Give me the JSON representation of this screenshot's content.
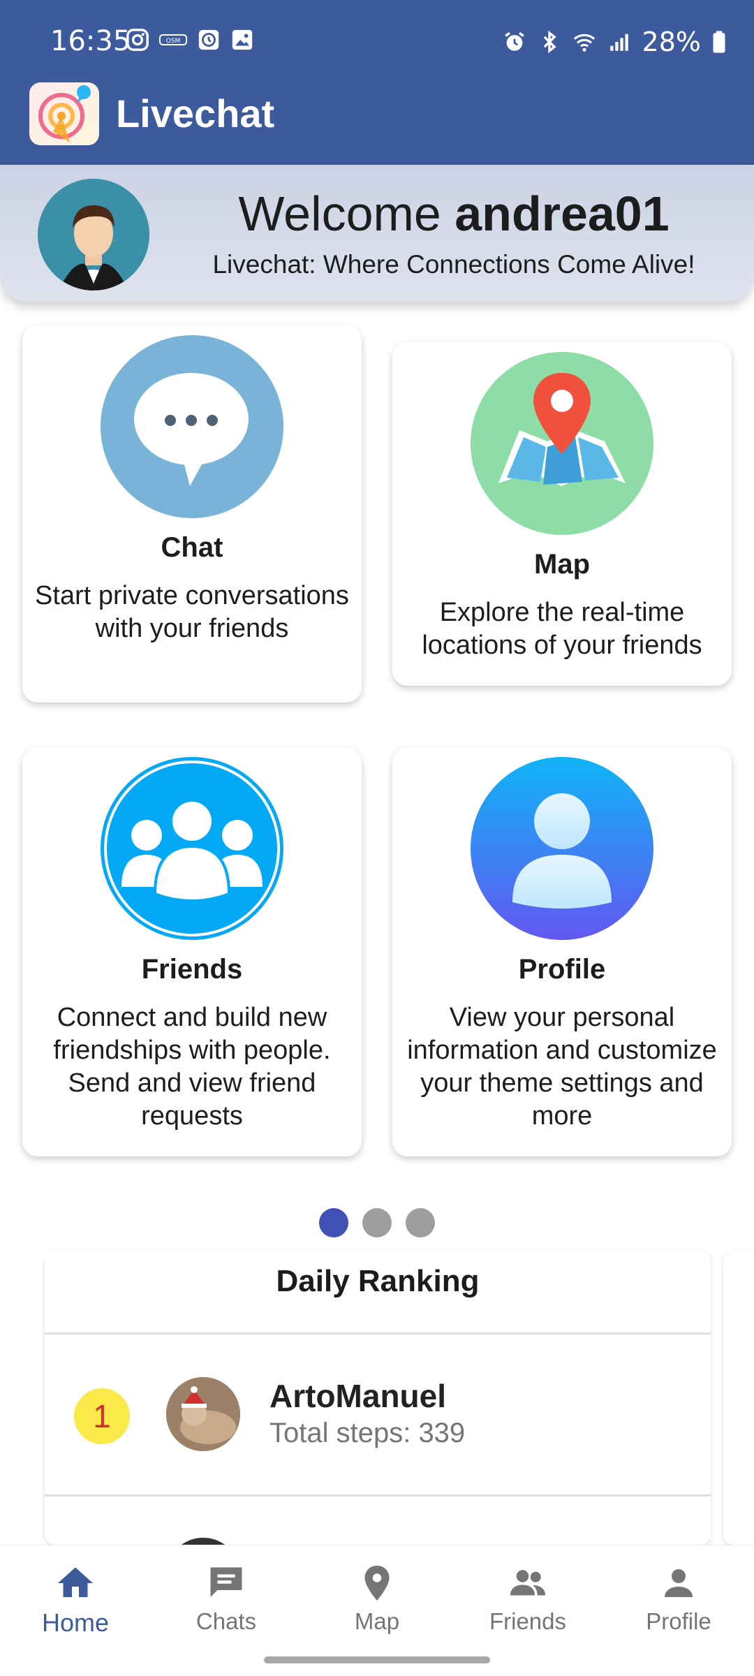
{
  "status_bar": {
    "time": "16:35",
    "battery": "28%",
    "left_icons": [
      "instagram-icon",
      "osm-icon",
      "clock-app-icon",
      "gallery-icon"
    ],
    "right_icons": [
      "alarm-icon",
      "bluetooth-icon",
      "wifi-icon",
      "signal-icon",
      "battery-icon"
    ]
  },
  "app_bar": {
    "title": "Livechat"
  },
  "welcome": {
    "greeting": "Welcome",
    "username": "andrea01",
    "tagline": "Livechat: Where Connections Come Alive!"
  },
  "cards": [
    {
      "title": "Chat",
      "description": "Start private conversations with your friends",
      "icon": "chat-bubble-icon"
    },
    {
      "title": "Map",
      "description": "Explore the real-time locations of your friends",
      "icon": "map-pin-icon"
    },
    {
      "title": "Friends",
      "description": "Connect and build new friendships with people. Send and view friend requests",
      "icon": "friends-group-icon"
    },
    {
      "title": "Profile",
      "description": "View your personal information and customize your theme settings and more",
      "icon": "profile-person-icon"
    }
  ],
  "carousel": {
    "pages": 3,
    "active_index": 0
  },
  "ranking": {
    "title": "Daily Ranking",
    "entries": [
      {
        "rank": "1",
        "name": "ArtoManuel",
        "steps": "Total steps: 339"
      }
    ]
  },
  "bottom_nav": {
    "items": [
      {
        "label": "Home",
        "icon": "home-icon",
        "active": true
      },
      {
        "label": "Chats",
        "icon": "chats-icon",
        "active": false
      },
      {
        "label": "Map",
        "icon": "map-icon",
        "active": false
      },
      {
        "label": "Friends",
        "icon": "friends-icon",
        "active": false
      },
      {
        "label": "Profile",
        "icon": "profile-icon",
        "active": false
      }
    ]
  },
  "colors": {
    "primary": "#3d5a9c",
    "active_dot": "#3f51b5",
    "chat_icon_bg": "#79b4d8",
    "map_icon_bg": "#8fdda6",
    "friends_icon_bg": "#03a9f4",
    "profile_icon_bg": "#3f8ef5",
    "rank_badge": "#fbe94a"
  }
}
